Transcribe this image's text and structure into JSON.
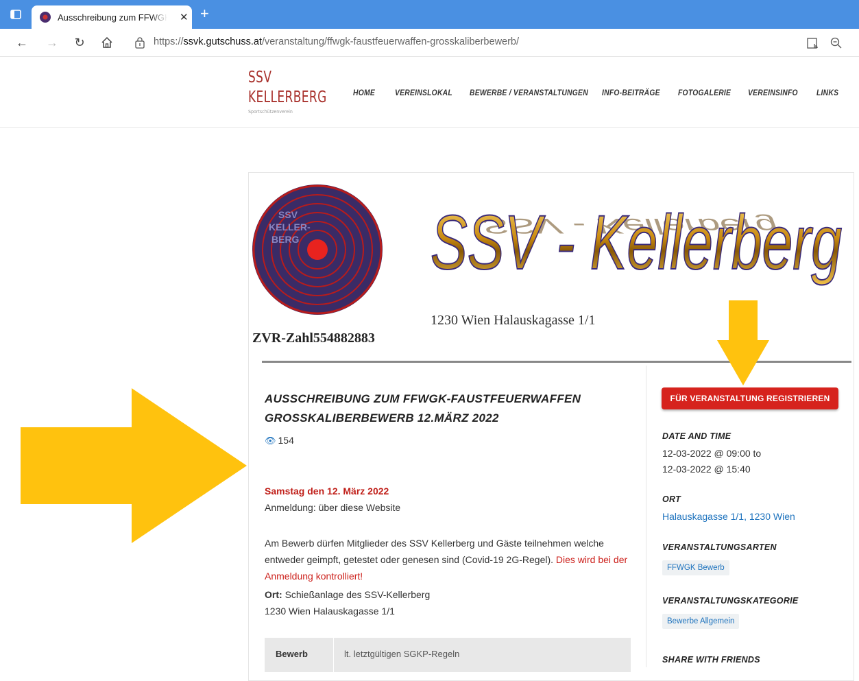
{
  "browser": {
    "tab_title": "Ausschreibung zum FFWGK-Faustfeuerwaffen Grosskaliberbewerb",
    "url_prefix": "https://",
    "url_domain": "ssvk.gutschuss.at",
    "url_path": "/veranstaltung/ffwgk-faustfeuerwaffen-grosskaliberbewerb/"
  },
  "site": {
    "logo_line1": "SSV",
    "logo_line2": "KELLERBERG",
    "logo_sub": "Sportschützenverein",
    "nav": [
      {
        "label": "HOME"
      },
      {
        "label": "VEREINSLOKAL"
      },
      {
        "label": "BEWERBE / VERANSTALTUNGEN"
      },
      {
        "label": "INFO-BEITRÄGE"
      },
      {
        "label": "FOTOGALERIE"
      },
      {
        "label": "VEREINSINFO"
      },
      {
        "label": "LINKS"
      }
    ]
  },
  "banner": {
    "emblem_l1": "SSV",
    "emblem_l2": "KELLER-",
    "emblem_l3": "BERG",
    "wordmark": "SSV - Kellerberg",
    "address": "1230 Wien Halauskagasse 1/1",
    "zvr": "ZVR-Zahl554882883"
  },
  "post": {
    "title": "AUSSCHREIBUNG ZUM FFWGK-FAUSTFEUERWAFFEN GROSSKALIBERBEWERB 12.MÄRZ 2022",
    "views": "154",
    "date_line": "Samstag den 12. März 2022",
    "registration_line": "Anmeldung: über diese Website",
    "body_text": "Am Bewerb dürfen Mitglieder des SSV Kellerberg und Gäste teilnehmen welche entweder geimpft, getestet oder genesen sind (Covid-19 2G-Regel).",
    "body_warning": "Dies wird bei der Anmeldung kontrolliert!",
    "ort_label": "Ort:",
    "ort_value": "Schießanlage des SSV-Kellerberg",
    "ort_address": "1230 Wien Halauskagasse 1/1",
    "table": [
      {
        "key": "Bewerb",
        "value": "lt. letztgültigen SGKP-Regeln"
      }
    ]
  },
  "sidebar": {
    "register_button": "FÜR VERANSTALTUNG REGISTRIEREN",
    "date_heading": "DATE AND TIME",
    "date_from": "12-03-2022 @ 09:00 to",
    "date_to": "12-03-2022 @ 15:40",
    "ort_heading": "ORT",
    "ort_link": "Halauskagasse 1/1, 1230 Wien",
    "types_heading": "VERANSTALTUNGSARTEN",
    "type_tag": "FFWGK Bewerb",
    "category_heading": "VERANSTALTUNGSKATEGORIE",
    "category_tag": "Bewerbe Allgemein",
    "share_heading": "SHARE WITH FRIENDS"
  },
  "colors": {
    "accent_red": "#d6231d",
    "link_blue": "#1e73be",
    "arrow_yellow": "#ffc20e",
    "browser_blue": "#4a90e2"
  }
}
